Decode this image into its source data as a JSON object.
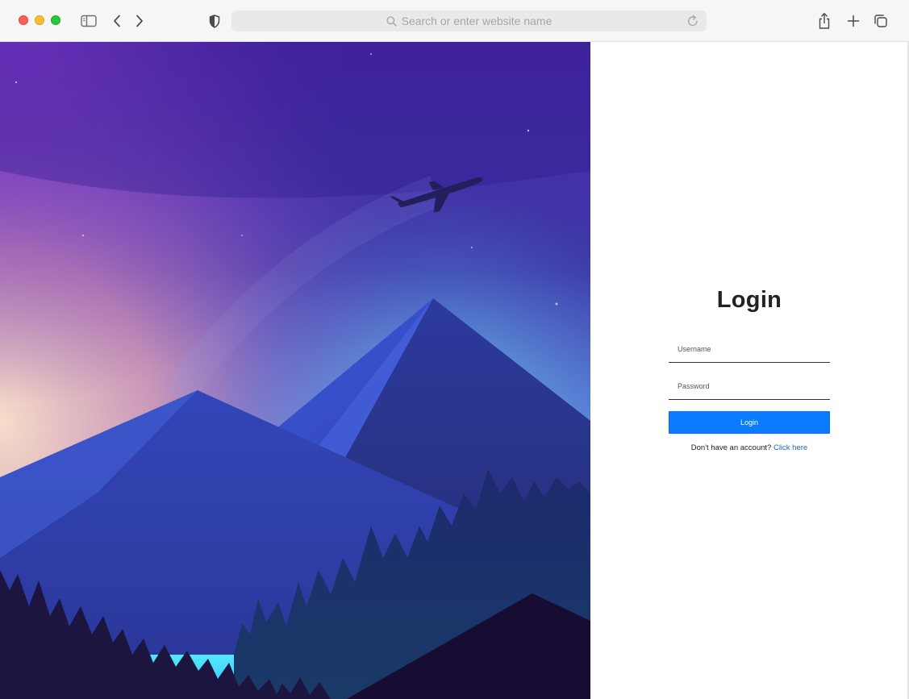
{
  "browser": {
    "address_placeholder": "Search or enter website name",
    "icons": [
      "sidebar-icon",
      "back-chevron-icon",
      "forward-chevron-icon",
      "privacy-shield-icon",
      "search-icon",
      "reload-icon",
      "share-icon",
      "plus-icon",
      "tabs-overview-icon"
    ]
  },
  "login": {
    "title": "Login",
    "username_placeholder": "Username",
    "password_placeholder": "Password",
    "button_label": "Login",
    "signup_prompt": "Don't have an account?",
    "signup_link": "Click here"
  },
  "colors": {
    "primary_button": "#0a7bff",
    "link": "#1769c6",
    "title": "#222222"
  }
}
